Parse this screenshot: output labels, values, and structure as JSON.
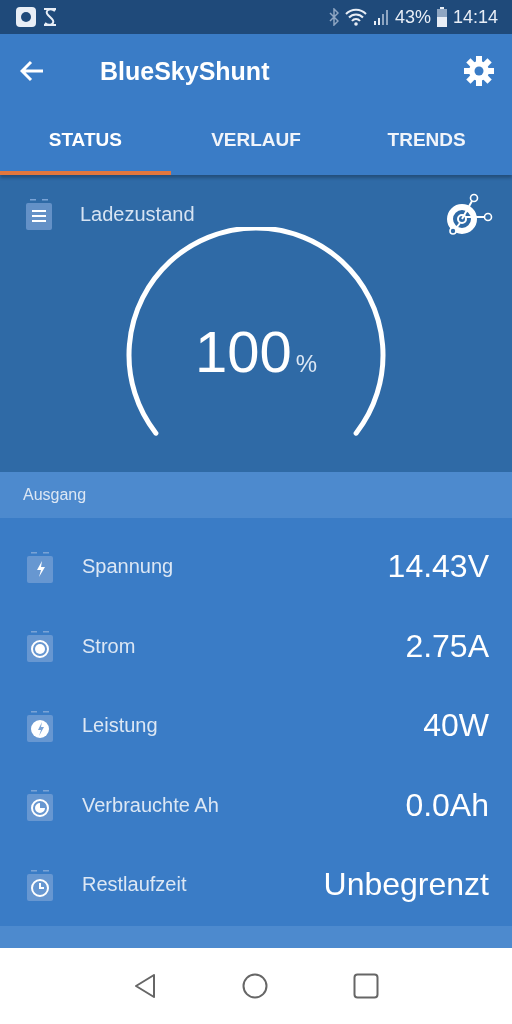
{
  "status_bar": {
    "battery": "43%",
    "time": "14:14"
  },
  "app_bar": {
    "title": "BlueSkyShunt"
  },
  "tabs": [
    {
      "label": "STATUS",
      "selected": true
    },
    {
      "label": "VERLAUF",
      "selected": false
    },
    {
      "label": "TRENDS",
      "selected": false
    }
  ],
  "gauge": {
    "title": "Ladezustand",
    "value": "100",
    "unit": "%"
  },
  "section": {
    "title": "Ausgang"
  },
  "rows": [
    {
      "kind": "voltage",
      "label": "Spannung",
      "value": "14.43V"
    },
    {
      "kind": "current",
      "label": "Strom",
      "value": "2.75A"
    },
    {
      "kind": "power",
      "label": "Leistung",
      "value": "40W"
    },
    {
      "kind": "consumed",
      "label": "Verbrauchte Ah",
      "value": "0.0Ah"
    },
    {
      "kind": "time",
      "label": "Restlaufzeit",
      "value": "Unbegrenzt"
    }
  ]
}
